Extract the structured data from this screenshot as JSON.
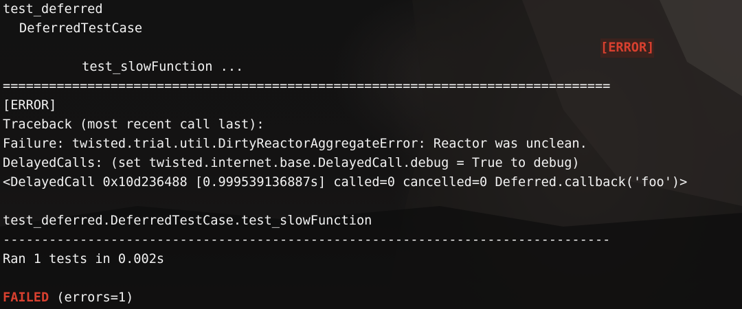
{
  "output": {
    "module": "test_deferred",
    "test_case": "DeferredTestCase",
    "test_name": "test_slowFunction ...",
    "test_status": "[ERROR]",
    "separator_equals": "===============================================================================",
    "error_header": "[ERROR]",
    "traceback": "Traceback (most recent call last):",
    "failure": "Failure: twisted.trial.util.DirtyReactorAggregateError: Reactor was unclean.",
    "delayed_calls": "DelayedCalls: (set twisted.internet.base.DelayedCall.debug = True to debug)",
    "delayed_call_detail": "<DelayedCall 0x10d236488 [0.999539136887s] called=0 cancelled=0 Deferred.callback('foo')>",
    "test_path": "test_deferred.DeferredTestCase.test_slowFunction",
    "separator_dashes": "-------------------------------------------------------------------------------",
    "summary": "Ran 1 tests in 0.002s",
    "result_label": "FAILED",
    "result_detail": " (errors=1)"
  },
  "colors": {
    "text": "#f2f2f2",
    "error": "#d8402f",
    "background": "#141414"
  }
}
